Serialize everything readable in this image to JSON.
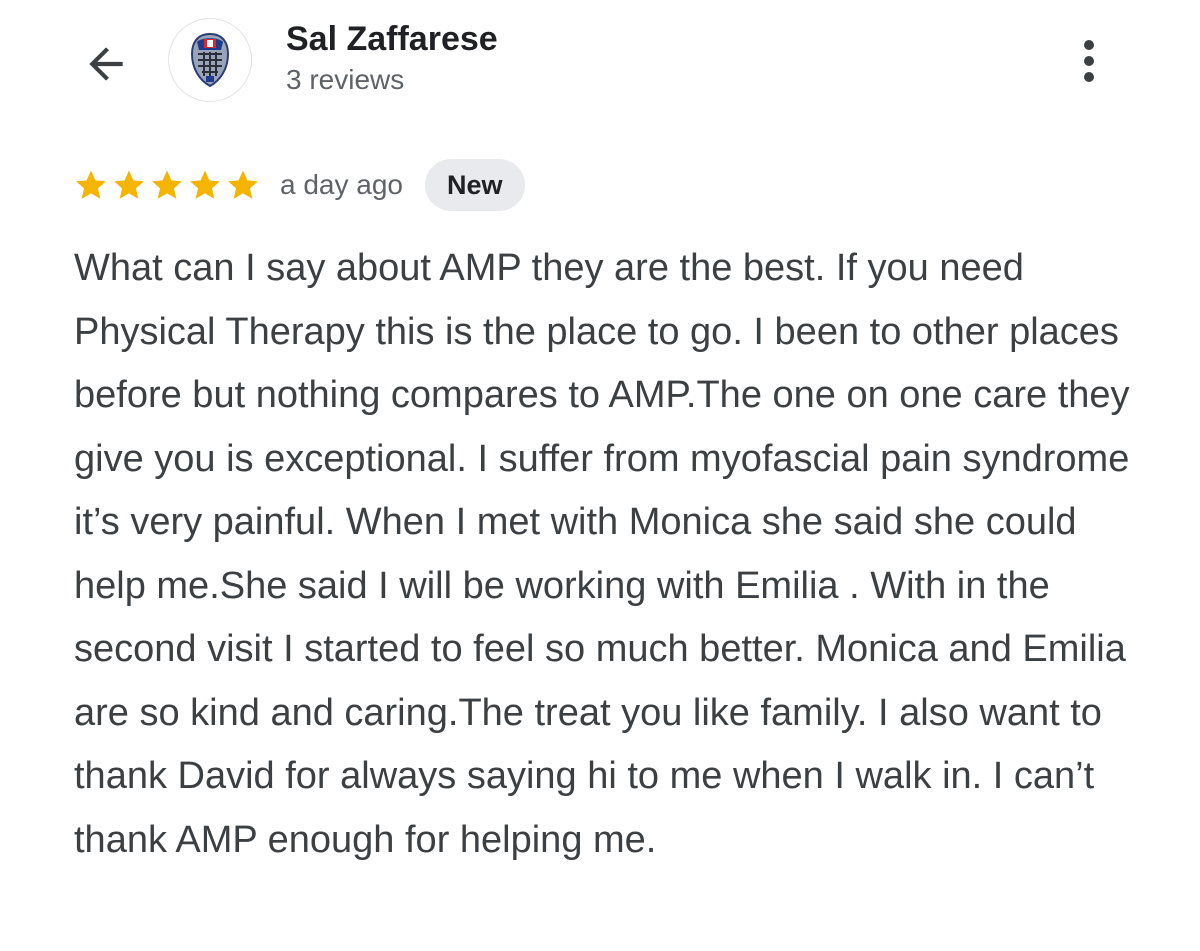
{
  "header": {
    "back_icon": "arrow-back-icon",
    "reviewer_name": "Sal Zaffarese",
    "review_count": "3 reviews",
    "more_icon": "more-vert-icon"
  },
  "review": {
    "rating": 5,
    "rating_max": 5,
    "star_color": "#f4b400",
    "time_ago": "a day ago",
    "badge": "New",
    "text": "What can I say about AMP they are the best. If you need Physical Therapy this is the place to go. I been to other places before but nothing compares to AMP.The one on one care they give you is exceptional. I suffer from myofascial pain syndrome it’s very painful. When I met with Monica she said she could help me.She said I will be working with Emilia . With in the second visit I started to feel so much better. Monica and Emilia are so kind and caring.The treat you like family. I also want to thank David for always saying hi to me when I walk in. I can’t thank AMP enough for helping me."
  }
}
